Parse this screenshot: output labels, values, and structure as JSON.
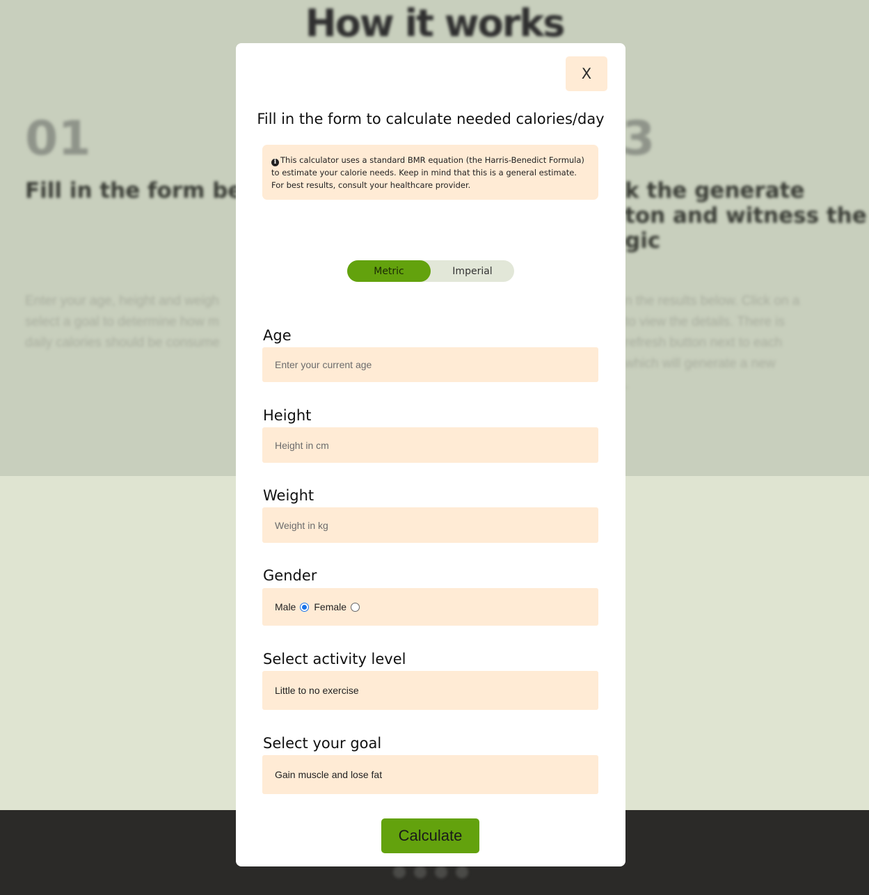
{
  "background": {
    "title": "How it works",
    "steps": [
      {
        "number": "01",
        "title": "Fill in the form belo",
        "desc_lines": [
          "Enter your age, height and weigh",
          "select a goal to determine how m",
          "daily calories should be consume"
        ]
      },
      {
        "number": "3",
        "title_lines": [
          "k the generate",
          "ton and witness the",
          "gic"
        ],
        "desc_lines": [
          "n the results below. Click on a",
          "to view the details. There is",
          "refresh button next to each",
          "which will generate a new",
          "."
        ]
      }
    ]
  },
  "modal": {
    "close_label": "X",
    "title": "Fill in the form to calculate needed calories/day",
    "info_icon": "info-circle-icon",
    "info_text": "This calculator uses a standard BMR equation (the Harris-Benedict Formula) to estimate your calorie needs. Keep in mind that this is a general estimate. For best results, consult your healthcare provider.",
    "units": {
      "options": [
        "Metric",
        "Imperial"
      ],
      "selected": "Metric"
    },
    "age": {
      "label": "Age",
      "placeholder": "Enter your current age",
      "value": ""
    },
    "height": {
      "label": "Height",
      "placeholder": "Height in cm",
      "value": ""
    },
    "weight": {
      "label": "Weight",
      "placeholder": "Weight in kg",
      "value": ""
    },
    "gender": {
      "label": "Gender",
      "options": [
        "Male",
        "Female"
      ],
      "selected": "Male"
    },
    "activity": {
      "label": "Select activity level",
      "value": "Little to no exercise"
    },
    "goal": {
      "label": "Select your goal",
      "value": "Gain muscle and lose fat"
    },
    "submit_label": "Calculate"
  },
  "colors": {
    "accent": "#63a20d",
    "field_bg": "#ffebd5",
    "overlay_top": "#c8cfbd",
    "footer": "#2b2a28"
  }
}
